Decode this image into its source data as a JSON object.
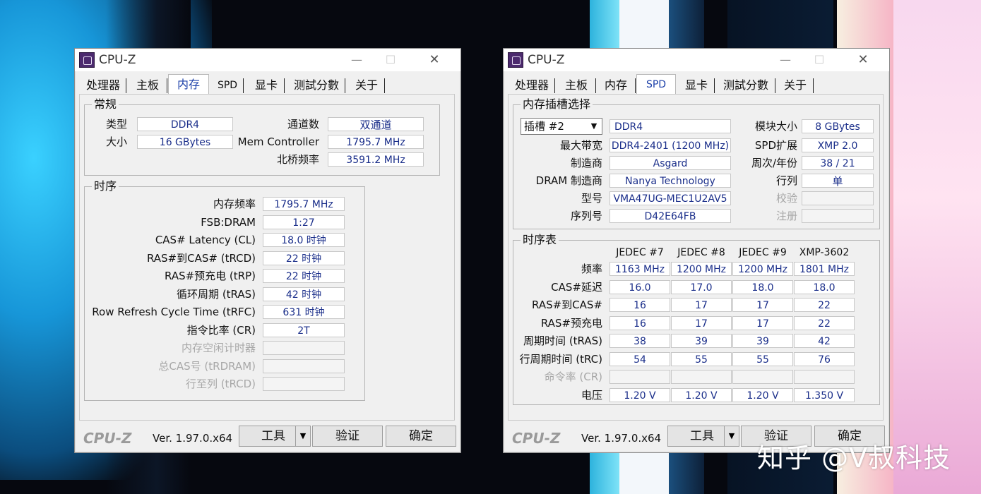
{
  "left": {
    "title": "CPU-Z",
    "tabs": [
      "处理器",
      "主板",
      "内存",
      "SPD",
      "显卡",
      "测試分數",
      "关于"
    ],
    "active_tab": "内存",
    "general": {
      "title": "常规",
      "type_label": "类型",
      "type_value": "DDR4",
      "size_label": "大小",
      "size_value": "16 GBytes",
      "channels_label": "通道数",
      "channels_value": "双通道",
      "mc_label": "Mem Controller",
      "mc_value": "1795.7 MHz",
      "nb_label": "北桥频率",
      "nb_value": "3591.2 MHz"
    },
    "timing": {
      "title": "时序",
      "rows": [
        {
          "label": "内存频率",
          "value": "1795.7 MHz"
        },
        {
          "label": "FSB:DRAM",
          "value": "1:27"
        },
        {
          "label": "CAS# Latency (CL)",
          "value": "18.0 时钟"
        },
        {
          "label": "RAS#到CAS# (tRCD)",
          "value": "22 时钟"
        },
        {
          "label": "RAS#预充电 (tRP)",
          "value": "22 时钟"
        },
        {
          "label": "循环周期 (tRAS)",
          "value": "42 时钟"
        },
        {
          "label": "Row Refresh Cycle Time (tRFC)",
          "value": "631 时钟"
        },
        {
          "label": "指令比率 (CR)",
          "value": "2T"
        },
        {
          "label": "内存空闲计时器",
          "value": ""
        },
        {
          "label": "总CAS号 (tRDRAM)",
          "value": ""
        },
        {
          "label": "行至列 (tRCD)",
          "value": ""
        }
      ]
    },
    "footer": {
      "brand": "CPU-Z",
      "version": "Ver. 1.97.0.x64",
      "tools": "工具",
      "validate": "验证",
      "ok": "确定"
    }
  },
  "right": {
    "title": "CPU-Z",
    "tabs": [
      "处理器",
      "主板",
      "内存",
      "SPD",
      "显卡",
      "测試分數",
      "关于"
    ],
    "active_tab": "SPD",
    "slot": {
      "title": "内存插槽选择",
      "slot_select": "插槽 #2",
      "type_value": "DDR4",
      "module_size_label": "模块大小",
      "module_size_value": "8 GBytes",
      "max_bw_label": "最大带宽",
      "max_bw_value": "DDR4-2401 (1200 MHz)",
      "spd_ext_label": "SPD扩展",
      "spd_ext_value": "XMP 2.0",
      "maker_label": "制造商",
      "maker_value": "Asgard",
      "week_year_label": "周次/年份",
      "week_year_value": "38 / 21",
      "dram_maker_label": "DRAM 制造商",
      "dram_maker_value": "Nanya Technology",
      "rank_label": "行列",
      "rank_value": "单",
      "part_label": "型号",
      "part_value": "VMA47UG-MEC1U2AV5",
      "correction_label": "校验",
      "correction_value": "",
      "serial_label": "序列号",
      "serial_value": "D42E64FB",
      "registered_label": "注册",
      "registered_value": ""
    },
    "timing_table": {
      "title": "时序表",
      "columns": [
        "JEDEC #7",
        "JEDEC #8",
        "JEDEC #9",
        "XMP-3602"
      ],
      "rows": [
        {
          "label": "频率",
          "values": [
            "1163 MHz",
            "1200 MHz",
            "1200 MHz",
            "1801 MHz"
          ]
        },
        {
          "label": "CAS#延迟",
          "values": [
            "16.0",
            "17.0",
            "18.0",
            "18.0"
          ]
        },
        {
          "label": "RAS#到CAS#",
          "values": [
            "16",
            "17",
            "17",
            "22"
          ]
        },
        {
          "label": "RAS#预充电",
          "values": [
            "16",
            "17",
            "17",
            "22"
          ]
        },
        {
          "label": "周期时间 (tRAS)",
          "values": [
            "38",
            "39",
            "39",
            "42"
          ]
        },
        {
          "label": "行周期时间 (tRC)",
          "values": [
            "54",
            "55",
            "55",
            "76"
          ]
        },
        {
          "label": "命令率 (CR)",
          "values": [
            "",
            "",
            "",
            ""
          ]
        },
        {
          "label": "电压",
          "values": [
            "1.20 V",
            "1.20 V",
            "1.20 V",
            "1.350 V"
          ]
        }
      ]
    },
    "footer": {
      "brand": "CPU-Z",
      "version": "Ver. 1.97.0.x64",
      "tools": "工具",
      "validate": "验证",
      "ok": "确定"
    }
  },
  "watermark": "知乎 @V叔科技"
}
